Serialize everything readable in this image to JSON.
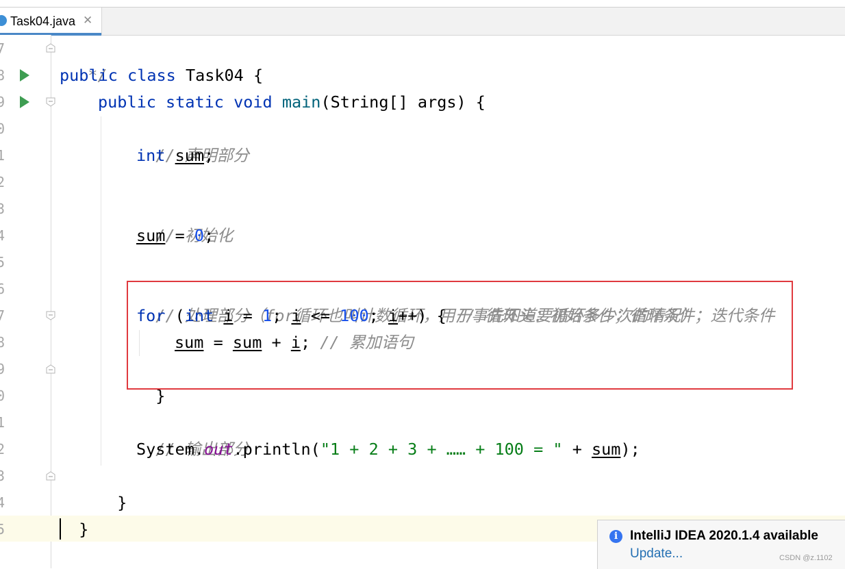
{
  "tab": {
    "filename": "Task04.java",
    "close_symbol": "✕",
    "icon": "java-class-icon"
  },
  "gutter": {
    "line_numbers": [
      "7",
      "8",
      "9",
      "0",
      "1",
      "2",
      "3",
      "4",
      "5",
      "6",
      "7",
      "8",
      "9",
      "0",
      "1",
      "2",
      "3",
      "4",
      "5"
    ],
    "run_markers": [
      "run-class-icon",
      "run-main-icon"
    ]
  },
  "code": {
    "l7": {
      "comment": "*/"
    },
    "l8": {
      "kw1": "public",
      "kw2": "class",
      "name": " Task04 {"
    },
    "l9": {
      "kw1": "public",
      "kw2": "static",
      "kw3": "void",
      "method": "main",
      "rest": "(String[] args) {"
    },
    "l10": {
      "comment": "// 声明部分"
    },
    "l11": {
      "kw": "int",
      "var": "sum",
      "rest": ";"
    },
    "l13": {
      "comment": "// 初始化"
    },
    "l14": {
      "var": "sum",
      "op": " = ",
      "num": "0",
      "rest": ";"
    },
    "l16": {
      "comment": "// 处理部分（for循环也叫计数循环，用于事先知道要循环多少次的情况）"
    },
    "l17": {
      "kw_for": "for",
      "p1": " (",
      "kw_int": "int",
      "sp": " ",
      "v_i": "i",
      "p2": " = ",
      "n1": "1",
      "p3": "; ",
      "v_i2": "i",
      "p4": " <= ",
      "n2": "100",
      "p5": "; ",
      "v_i3": "i",
      "p6": "++) { ",
      "comment": "// 循环头：初始条件；循环条件；迭代条件"
    },
    "l18": {
      "v_sum": "sum",
      "p1": " = ",
      "v_sum2": "sum",
      "p2": " + ",
      "v_i": "i",
      "p3": "; ",
      "comment": "// 累加语句"
    },
    "l19": {
      "brace": "}"
    },
    "l21": {
      "comment": "// 输出部分"
    },
    "l22": {
      "cls": "System.",
      "field": "out",
      "call": ".println(",
      "str": "\"1 + 2 + 3 + …… + 100 = \"",
      "p1": " + ",
      "var": "sum",
      "p2": ");"
    },
    "l23": {
      "brace": "}"
    },
    "l24": {
      "brace": "}"
    }
  },
  "notification": {
    "title": "IntelliJ IDEA 2020.1.4 available",
    "link": "Update...",
    "icon": "info-icon",
    "icon_glyph": "i"
  },
  "watermark": "CSDN @z.1102",
  "colors": {
    "keyword": "#0033b3",
    "comment": "#8c8c8c",
    "number": "#1750eb",
    "string": "#067d17",
    "field": "#871094",
    "highlight_box": "#e0393e",
    "tab_accent": "#4a88c7"
  }
}
